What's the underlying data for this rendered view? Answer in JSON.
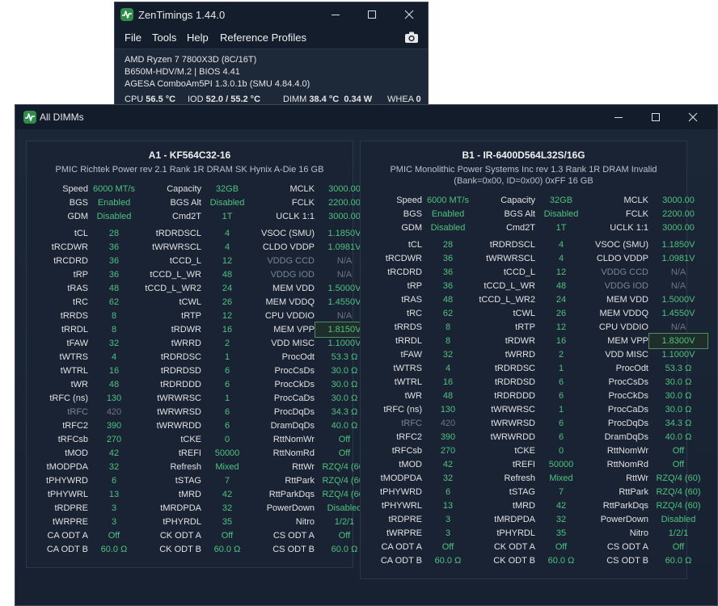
{
  "main_window": {
    "title": "ZenTimings 1.44.0",
    "menu": [
      "File",
      "Tools",
      "Help",
      "Reference Profiles"
    ],
    "cpu_model": "AMD Ryzen 7 7800X3D (8C/16T)",
    "board_bios": "B650M-HDV/M.2 | BIOS 4.41",
    "agesa": "AGESA ComboAm5PI 1.3.0.1b (SMU 4.84.4.0)",
    "stats": {
      "cpu_label": "CPU",
      "cpu_value": "56.5 °C",
      "iod_label": "IOD",
      "iod_value": "52.0 / 55.2 °C",
      "dimm_label": "DIMM",
      "dimm_value": "38.4 °C",
      "dimm_power": "0.34 W",
      "whea_label": "WHEA",
      "whea_value": "0"
    }
  },
  "dimm_window": {
    "title": "All DIMMs",
    "panels": [
      {
        "header": "A1  -  KF564C32-16",
        "sub": [
          "PMIC Richtek Power rev 2.1    Rank 1R    DRAM SK Hynix A-Die    16 GB"
        ],
        "rows": [
          [
            [
              "Speed",
              "6000 MT/s"
            ],
            [
              "Capacity",
              "32GB"
            ],
            [
              "MCLK",
              "3000.00"
            ]
          ],
          [
            [
              "BGS",
              "Enabled"
            ],
            [
              "BGS Alt",
              "Disabled"
            ],
            [
              "FCLK",
              "2200.00"
            ]
          ],
          [
            [
              "GDM",
              "Disabled"
            ],
            [
              "Cmd2T",
              "1T"
            ],
            [
              "UCLK  1:1",
              "3000.00"
            ]
          ],
          null,
          [
            [
              "tCL",
              "28"
            ],
            [
              "tRDRDSCL",
              "4"
            ],
            [
              "VSOC (SMU)",
              "1.1850V"
            ]
          ],
          [
            [
              "tRCDWR",
              "36"
            ],
            [
              "tWRWRSCL",
              "4"
            ],
            [
              "CLDO VDDP",
              "1.0981V"
            ]
          ],
          [
            [
              "tRCDRD",
              "36"
            ],
            [
              "tCCD_L",
              "12"
            ],
            [
              "VDDG CCD",
              "N/A"
            ]
          ],
          [
            [
              "tRP",
              "36"
            ],
            [
              "tCCD_L_WR",
              "48"
            ],
            [
              "VDDG IOD",
              "N/A"
            ]
          ],
          [
            [
              "tRAS",
              "48"
            ],
            [
              "tCCD_L_WR2",
              "24"
            ],
            [
              "MEM VDD",
              "1.5000V"
            ]
          ],
          [
            [
              "tRC",
              "62"
            ],
            [
              "tCWL",
              "26"
            ],
            [
              "MEM VDDQ",
              "1.4550V"
            ]
          ],
          [
            [
              "tRRDS",
              "8"
            ],
            [
              "tRTP",
              "12"
            ],
            [
              "CPU VDDIO",
              "N/A"
            ]
          ],
          [
            [
              "tRRDL",
              "8"
            ],
            [
              "tRDWR",
              "16"
            ],
            [
              "MEM VPP",
              "1.8150V"
            ]
          ],
          [
            [
              "tFAW",
              "32"
            ],
            [
              "tWRRD",
              "2"
            ],
            [
              "VDD MISC",
              "1.1000V"
            ]
          ],
          [
            [
              "tWTRS",
              "4"
            ],
            [
              "tRDRDSC",
              "1"
            ],
            [
              "ProcOdt",
              "53.3 Ω"
            ]
          ],
          [
            [
              "tWTRL",
              "16"
            ],
            [
              "tRDRDSD",
              "6"
            ],
            [
              "ProcCsDs",
              "30.0 Ω"
            ]
          ],
          [
            [
              "tWR",
              "48"
            ],
            [
              "tRDRDDD",
              "6"
            ],
            [
              "ProcCkDs",
              "30.0 Ω"
            ]
          ],
          [
            [
              "tRFC (ns)",
              "130"
            ],
            [
              "tWRWRSC",
              "1"
            ],
            [
              "ProcCaDs",
              "30.0 Ω"
            ]
          ],
          [
            [
              "tRFC",
              "420"
            ],
            [
              "tWRWRSD",
              "6"
            ],
            [
              "ProcDqDs",
              "34.3 Ω"
            ]
          ],
          [
            [
              "tRFC2",
              "390"
            ],
            [
              "tWRWRDD",
              "6"
            ],
            [
              "DramDqDs",
              "40.0 Ω"
            ]
          ],
          [
            [
              "tRFCsb",
              "270"
            ],
            [
              "tCKE",
              "0"
            ],
            [
              "RttNomWr",
              "Off"
            ]
          ],
          [
            [
              "tMOD",
              "42"
            ],
            [
              "tREFI",
              "50000"
            ],
            [
              "RttNomRd",
              "Off"
            ]
          ],
          [
            [
              "tMODPDA",
              "32"
            ],
            [
              "Refresh",
              "Mixed"
            ],
            [
              "RttWr",
              "RZQ/4 (60)"
            ]
          ],
          [
            [
              "tPHYWRD",
              "6"
            ],
            [
              "tSTAG",
              "7"
            ],
            [
              "RttPark",
              "RZQ/4 (60)"
            ]
          ],
          [
            [
              "tPHYWRL",
              "13"
            ],
            [
              "tMRD",
              "42"
            ],
            [
              "RttParkDqs",
              "RZQ/4 (60)"
            ]
          ],
          [
            [
              "tRDPRE",
              "3"
            ],
            [
              "tMRDPDA",
              "32"
            ],
            [
              "PowerDown",
              "Disabled"
            ]
          ],
          [
            [
              "tWRPRE",
              "3"
            ],
            [
              "tPHYRDL",
              "35"
            ],
            [
              "Nitro",
              "1/2/1"
            ]
          ],
          [
            [
              "CA ODT A",
              "Off"
            ],
            [
              "CK ODT A",
              "Off"
            ],
            [
              "CS ODT A",
              "Off"
            ]
          ],
          [
            [
              "CA ODT B",
              "60.0 Ω"
            ],
            [
              "CK ODT B",
              "60.0 Ω"
            ],
            [
              "CS ODT B",
              "60.0 Ω"
            ]
          ]
        ]
      },
      {
        "header": "B1  -  IR-6400D564L32S/16G",
        "sub": [
          "PMIC Monolithic Power Systems Inc rev 1.3    Rank 1R    DRAM Invalid",
          "(Bank=0x00, ID=0x00) 0xFF    16 GB"
        ],
        "rows": [
          [
            [
              "Speed",
              "6000 MT/s"
            ],
            [
              "Capacity",
              "32GB"
            ],
            [
              "MCLK",
              "3000.00"
            ]
          ],
          [
            [
              "BGS",
              "Enabled"
            ],
            [
              "BGS Alt",
              "Disabled"
            ],
            [
              "FCLK",
              "2200.00"
            ]
          ],
          [
            [
              "GDM",
              "Disabled"
            ],
            [
              "Cmd2T",
              "1T"
            ],
            [
              "UCLK  1:1",
              "3000.00"
            ]
          ],
          null,
          [
            [
              "tCL",
              "28"
            ],
            [
              "tRDRDSCL",
              "4"
            ],
            [
              "VSOC (SMU)",
              "1.1850V"
            ]
          ],
          [
            [
              "tRCDWR",
              "36"
            ],
            [
              "tWRWRSCL",
              "4"
            ],
            [
              "CLDO VDDP",
              "1.0981V"
            ]
          ],
          [
            [
              "tRCDRD",
              "36"
            ],
            [
              "tCCD_L",
              "12"
            ],
            [
              "VDDG CCD",
              "N/A"
            ]
          ],
          [
            [
              "tRP",
              "36"
            ],
            [
              "tCCD_L_WR",
              "48"
            ],
            [
              "VDDG IOD",
              "N/A"
            ]
          ],
          [
            [
              "tRAS",
              "48"
            ],
            [
              "tCCD_L_WR2",
              "24"
            ],
            [
              "MEM VDD",
              "1.5000V"
            ]
          ],
          [
            [
              "tRC",
              "62"
            ],
            [
              "tCWL",
              "26"
            ],
            [
              "MEM VDDQ",
              "1.4550V"
            ]
          ],
          [
            [
              "tRRDS",
              "8"
            ],
            [
              "tRTP",
              "12"
            ],
            [
              "CPU VDDIO",
              "N/A"
            ]
          ],
          [
            [
              "tRRDL",
              "8"
            ],
            [
              "tRDWR",
              "16"
            ],
            [
              "MEM VPP",
              "1.8300V"
            ]
          ],
          [
            [
              "tFAW",
              "32"
            ],
            [
              "tWRRD",
              "2"
            ],
            [
              "VDD MISC",
              "1.1000V"
            ]
          ],
          [
            [
              "tWTRS",
              "4"
            ],
            [
              "tRDRDSC",
              "1"
            ],
            [
              "ProcOdt",
              "53.3 Ω"
            ]
          ],
          [
            [
              "tWTRL",
              "16"
            ],
            [
              "tRDRDSD",
              "6"
            ],
            [
              "ProcCsDs",
              "30.0 Ω"
            ]
          ],
          [
            [
              "tWR",
              "48"
            ],
            [
              "tRDRDDD",
              "6"
            ],
            [
              "ProcCkDs",
              "30.0 Ω"
            ]
          ],
          [
            [
              "tRFC (ns)",
              "130"
            ],
            [
              "tWRWRSC",
              "1"
            ],
            [
              "ProcCaDs",
              "30.0 Ω"
            ]
          ],
          [
            [
              "tRFC",
              "420"
            ],
            [
              "tWRWRSD",
              "6"
            ],
            [
              "ProcDqDs",
              "34.3 Ω"
            ]
          ],
          [
            [
              "tRFC2",
              "390"
            ],
            [
              "tWRWRDD",
              "6"
            ],
            [
              "DramDqDs",
              "40.0 Ω"
            ]
          ],
          [
            [
              "tRFCsb",
              "270"
            ],
            [
              "tCKE",
              "0"
            ],
            [
              "RttNomWr",
              "Off"
            ]
          ],
          [
            [
              "tMOD",
              "42"
            ],
            [
              "tREFI",
              "50000"
            ],
            [
              "RttNomRd",
              "Off"
            ]
          ],
          [
            [
              "tMODPDA",
              "32"
            ],
            [
              "Refresh",
              "Mixed"
            ],
            [
              "RttWr",
              "RZQ/4 (60)"
            ]
          ],
          [
            [
              "tPHYWRD",
              "6"
            ],
            [
              "tSTAG",
              "7"
            ],
            [
              "RttPark",
              "RZQ/4 (60)"
            ]
          ],
          [
            [
              "tPHYWRL",
              "13"
            ],
            [
              "tMRD",
              "42"
            ],
            [
              "RttParkDqs",
              "RZQ/4 (60)"
            ]
          ],
          [
            [
              "tRDPRE",
              "3"
            ],
            [
              "tMRDPDA",
              "32"
            ],
            [
              "PowerDown",
              "Disabled"
            ]
          ],
          [
            [
              "tWRPRE",
              "3"
            ],
            [
              "tPHYRDL",
              "35"
            ],
            [
              "Nitro",
              "1/2/1"
            ]
          ],
          [
            [
              "CA ODT A",
              "Off"
            ],
            [
              "CK ODT A",
              "Off"
            ],
            [
              "CS ODT A",
              "Off"
            ]
          ],
          [
            [
              "CA ODT B",
              "60.0 Ω"
            ],
            [
              "CK ODT B",
              "60.0 Ω"
            ],
            [
              "CS ODT B",
              "60.0 Ω"
            ]
          ]
        ]
      }
    ]
  },
  "colors": {
    "value_green": "#4ec27e",
    "disabled_gray": "#6b7684",
    "window_bg": "#131d2b",
    "panel_bg": "#192334"
  }
}
